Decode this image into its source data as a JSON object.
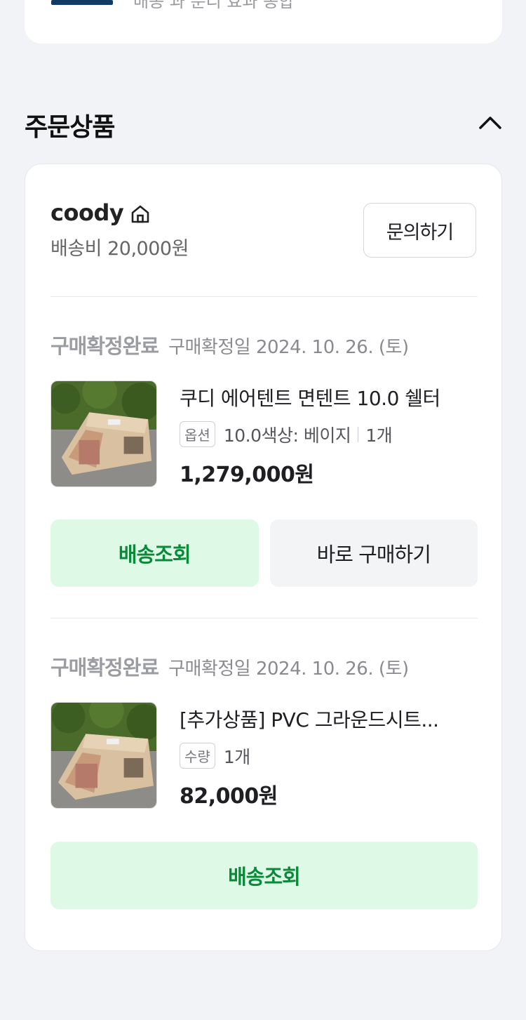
{
  "top_card": {
    "cut_text": "배송 과 분리 효과 종합"
  },
  "section": {
    "title": "주문상품"
  },
  "seller": {
    "name": "coody",
    "shipping_fee": "배송비 20,000원",
    "inquiry_label": "문의하기"
  },
  "orders": [
    {
      "status": "구매확정완료",
      "confirm_date": "구매확정일 2024. 10. 26. (토)",
      "product_name": "쿠디 에어텐트 면텐트 10.0 쉘터",
      "option_badge": "옵션",
      "option_text": "10.0색상: 베이지",
      "quantity": "1개",
      "price": "1,279,000원",
      "buttons": {
        "track": "배송조회",
        "buy_again": "바로 구매하기"
      }
    },
    {
      "status": "구매확정완료",
      "confirm_date": "구매확정일 2024. 10. 26. (토)",
      "product_name": "[추가상품] PVC 그라운드시트...",
      "option_badge": "수량",
      "quantity": "1개",
      "price": "82,000원",
      "buttons": {
        "track": "배송조회"
      }
    }
  ],
  "colors": {
    "accent_green": "#098a39",
    "green_bg": "#def9e5",
    "page_bg": "#f2f3f6"
  }
}
